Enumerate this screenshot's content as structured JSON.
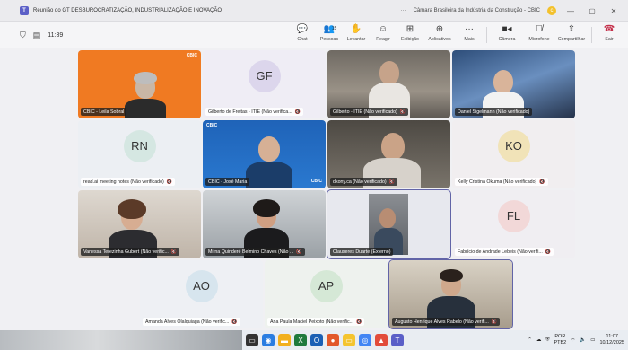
{
  "window": {
    "title": "Reunião do GT DESBUROCRATIZAÇÃO, INDUSTRIALIZAÇÃO E INOVAÇÃO",
    "more": "···",
    "org": "Câmara Brasileira da Indústria da Construção - CBIC",
    "badge": "c",
    "min": "—",
    "max": "▢",
    "close": "✕"
  },
  "toolbar": {
    "elapsed": "11:39",
    "people_count": "15",
    "items": {
      "chat": "Chat",
      "people": "Pessoas",
      "raise": "Levantar",
      "react": "Reagir",
      "view": "Exibição",
      "apps": "Aplicativos",
      "more": "Mais",
      "camera": "Câmera",
      "mic": "Microfone",
      "share": "Compartilhar",
      "leave": "Sair"
    }
  },
  "tiles": [
    {
      "label": "CBIC - Leila Sobral",
      "brand": "CBIC"
    },
    {
      "label": "Gilberto de Freitas - ITIE (Não verifica...",
      "initials": "GF"
    },
    {
      "label": "Gilberto - ITIE (Não verificado)"
    },
    {
      "label": "Daniel Sigelmann (Não verificado)"
    },
    {
      "label": "read.ai meeting notes (Não verificado)",
      "initials": "RN"
    },
    {
      "label": "CBIC - José Maria",
      "brand": "CBIC",
      "brand2": "CBIC"
    },
    {
      "label": "dkony.ca (Não verificado)"
    },
    {
      "label": "Kelly Cristina Okuma (Não verificado)",
      "initials": "KO"
    },
    {
      "label": "Vanessa Terezinha Gubert (Não verific..."
    },
    {
      "label": "Mirna Quinderé Belmino Chaves (Não ..."
    },
    {
      "label": "Clauseres Duarte (Externo)"
    },
    {
      "label": "Fabrício de Andrade Lebeis (Não verifi...",
      "initials": "FL"
    },
    {
      "label": "Amanda Alves Olalquiaga (Não verific...",
      "initials": "AO"
    },
    {
      "label": "Ana Paula Maciel Peixoto (Não verific...",
      "initials": "AP"
    },
    {
      "label": "Augusto Henrique Alves Rabelo (Não verifi..."
    }
  ],
  "taskbar": {
    "lang": "POR",
    "layout": "PTB2",
    "time": "11:07",
    "date": "10/12/2025"
  },
  "colors": {
    "accent": "#5b5fc7",
    "leave": "#c4314b",
    "cbic_orange": "#f07a22",
    "cbic_blue": "#1f63b8"
  }
}
